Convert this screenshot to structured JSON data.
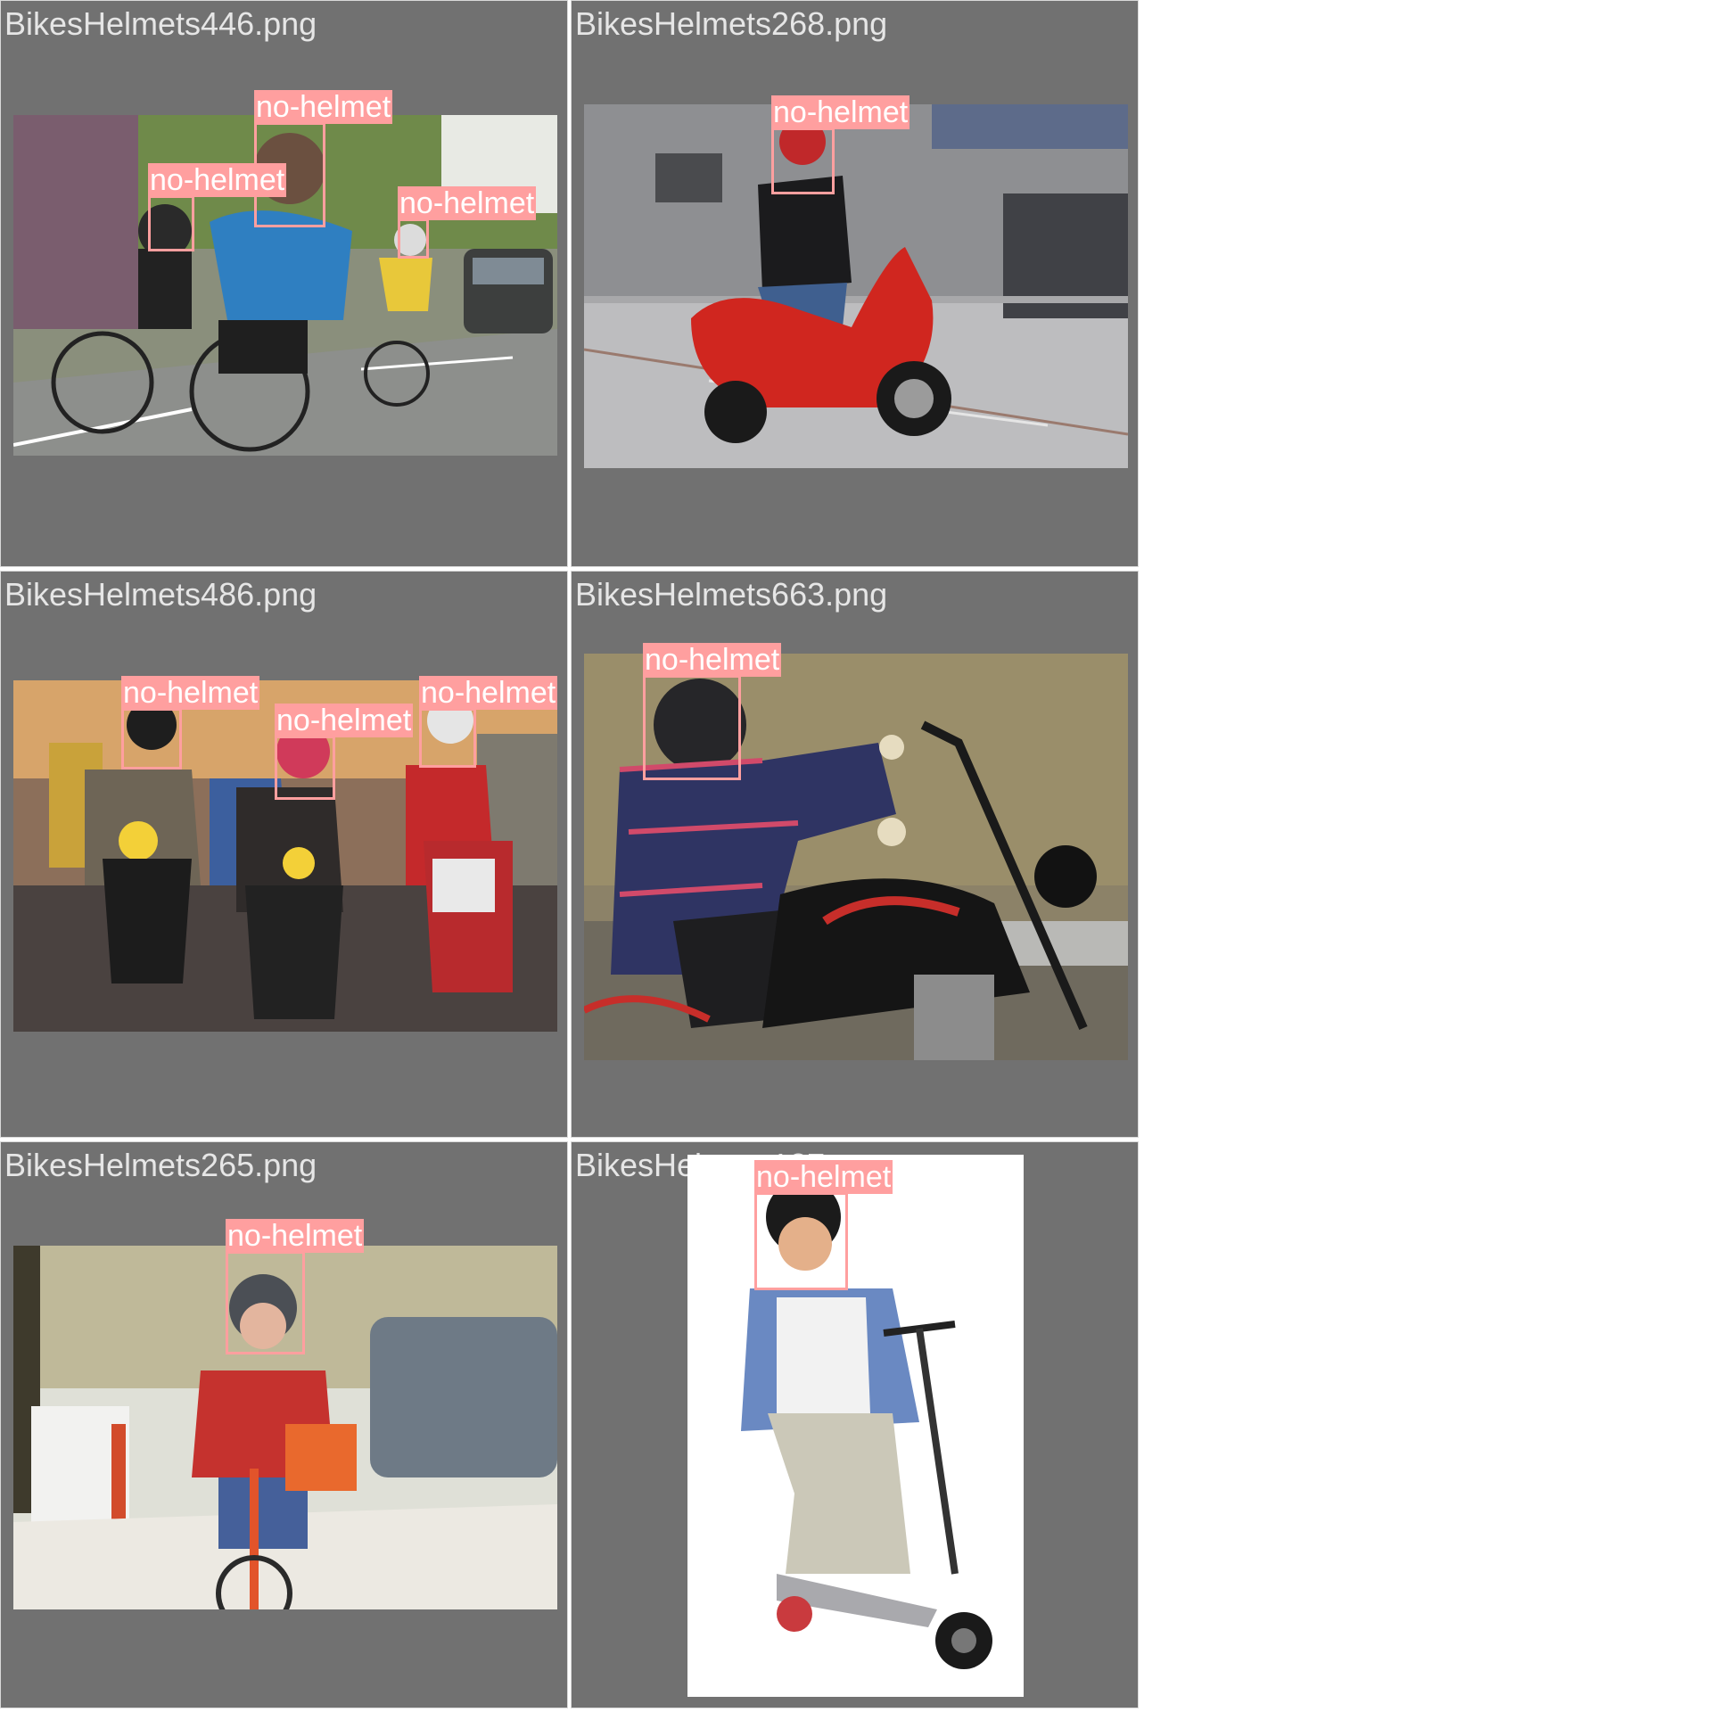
{
  "grid": {
    "cells": [
      {
        "filename": "BikesHelmets446.png",
        "detections": [
          "no-helmet",
          "no-helmet",
          "no-helmet"
        ]
      },
      {
        "filename": "BikesHelmets268.png",
        "detections": [
          "no-helmet"
        ]
      },
      {
        "filename": "BikesHelmets486.png",
        "detections": [
          "no-helmet",
          "no-helmet",
          "no-helmet"
        ]
      },
      {
        "filename": "BikesHelmets663.png",
        "detections": [
          "no-helmet"
        ]
      },
      {
        "filename": "BikesHelmets265.png",
        "detections": [
          "no-helmet"
        ]
      },
      {
        "filename": "BikesHelmets127.png",
        "detections": [
          "no-helmet"
        ]
      }
    ]
  },
  "colors": {
    "panel_bg": "#717171",
    "label_bg": "#ff9f9f",
    "label_text": "#ffffff",
    "filename_text": "#e6e6e6"
  }
}
